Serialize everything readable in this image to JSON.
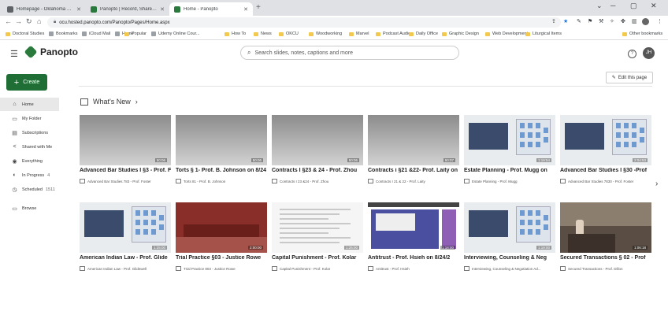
{
  "browser": {
    "tabs": [
      {
        "title": "Homepage - Oklahoma City Univ...",
        "active": false,
        "color": "#5f6368"
      },
      {
        "title": "Panopto | Record, Share, and Ma...",
        "active": false,
        "color": "#2b7a3d"
      },
      {
        "title": "Home - Panopto",
        "active": true,
        "color": "#2b7a3d"
      }
    ],
    "url": "ocu.hosted.panopto.com/Panopto/Pages/Home.aspx",
    "bookmarks": [
      {
        "label": "Doctoral Studies",
        "type": "folder"
      },
      {
        "label": "Bookmarks",
        "type": "star"
      },
      {
        "label": "iCloud Mail",
        "type": "site"
      },
      {
        "label": "Home",
        "type": "site"
      },
      {
        "label": "Popular",
        "type": "folder"
      },
      {
        "label": "Udemy Online Cour...",
        "type": "site"
      },
      {
        "label": "How To",
        "type": "folder"
      },
      {
        "label": "News",
        "type": "folder"
      },
      {
        "label": "OKCU",
        "type": "folder"
      },
      {
        "label": "Woodworking",
        "type": "folder"
      },
      {
        "label": "Marvel",
        "type": "folder"
      },
      {
        "label": "Podcast Audio",
        "type": "folder"
      },
      {
        "label": "Daily Office",
        "type": "folder"
      },
      {
        "label": "Graphic Design",
        "type": "folder"
      },
      {
        "label": "Web Development",
        "type": "folder"
      },
      {
        "label": "Liturgical Items",
        "type": "folder"
      }
    ],
    "other_bookmarks": "Other bookmarks"
  },
  "app": {
    "logo_text": "Panopto",
    "search_placeholder": "Search slides, notes, captions and more",
    "avatar_initials": "JH",
    "create_label": "Create",
    "edit_page_label": "Edit this page",
    "section_title": "What's New"
  },
  "sidebar": {
    "items": [
      {
        "label": "Home",
        "icon": "home-icon",
        "glyph": "⌂",
        "count": "",
        "active": true
      },
      {
        "label": "My Folder",
        "icon": "folder-icon",
        "glyph": "▭",
        "count": "",
        "active": false
      },
      {
        "label": "Subscriptions",
        "icon": "subscriptions-icon",
        "glyph": "▤",
        "count": "",
        "active": false
      },
      {
        "label": "Shared with Me",
        "icon": "share-icon",
        "glyph": "<",
        "count": "",
        "active": false
      },
      {
        "label": "Everything",
        "icon": "everything-icon",
        "glyph": "◉",
        "count": "",
        "active": false
      },
      {
        "label": "In Progress",
        "icon": "progress-icon",
        "glyph": "◐",
        "count": "4",
        "active": false
      },
      {
        "label": "Scheduled",
        "icon": "schedule-icon",
        "glyph": "◷",
        "count": "1511",
        "active": false
      },
      {
        "label": "Browse",
        "icon": "browse-icon",
        "glyph": "▭",
        "count": "",
        "active": false
      }
    ]
  },
  "sessions": [
    {
      "title": "Advanced Bar Studies I §3 - Prof. Foster",
      "folder": "Advanced Bar Studies 783 - Prof. Foster",
      "duration": "50:06",
      "thumb": "gray"
    },
    {
      "title": "Torts § 1- Prof. B. Johnson on 8/24",
      "folder": "Torts 81 - Prof. B. Johnson",
      "duration": "50:06",
      "thumb": "gray"
    },
    {
      "title": "Contracts I §23 & 24 - Prof. Zhou",
      "folder": "Contracts I 23 &24 - Prof. Zhou",
      "duration": "50:06",
      "thumb": "gray"
    },
    {
      "title": "Contracts i §21 &22- Prof. Laity on",
      "folder": "Contracts I 21 & 22 - Prof. Laity",
      "duration": "50:07",
      "thumb": "gray"
    },
    {
      "title": "Estate Planning - Prof. Mugg on",
      "folder": "Estate Planning - Prof. Mugg",
      "duration": "1:19:54",
      "thumb": "building"
    },
    {
      "title": "Advanced Bar Studies I §30 -Prof",
      "folder": "Advanced Bar Studies 7830 - Prof. Foster",
      "duration": "2:04:53",
      "thumb": "building"
    },
    {
      "title": "American Indian Law - Prof. Glide",
      "folder": "American Indian Law - Prof. Glidewell",
      "duration": "1:25:00",
      "thumb": "building"
    },
    {
      "title": "Trial Practice §03 - Justice Rowe",
      "folder": "Trial Practice 803 - Justice Rowe",
      "duration": "2:00:00",
      "thumb": "court"
    },
    {
      "title": "Capital Punishment - Prof. Kolar",
      "folder": "Capital Punishment - Prof. Kolar",
      "duration": "1:25:00",
      "thumb": "doc"
    },
    {
      "title": "Antitrust - Prof. Hsieh on 8/24/2",
      "folder": "Antitrust - Prof. Hsieh",
      "duration": "1:18:00",
      "thumb": "slide"
    },
    {
      "title": "Interviewing, Counseling & Neg",
      "folder": "Interviewing, Counseling & Negotiation Ad...",
      "duration": "1:19:00",
      "thumb": "building"
    },
    {
      "title": "Secured Transactions § 02 - Prof",
      "folder": "Secured Transactions - Prof. Dillon",
      "duration": "1:06:18",
      "thumb": "room"
    }
  ]
}
